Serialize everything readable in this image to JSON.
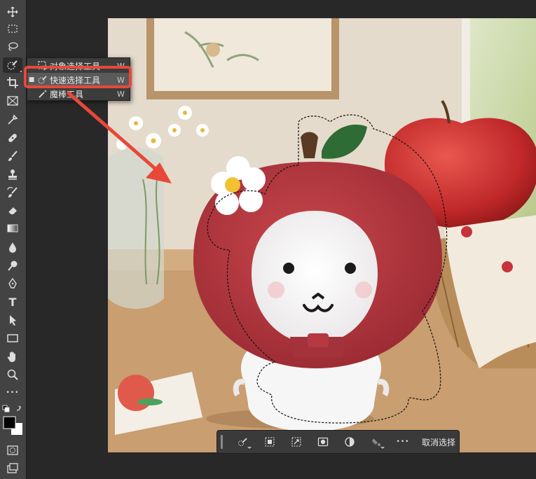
{
  "toolbar": {
    "tools": [
      "move-tool-icon",
      "marquee-tool-icon",
      "lasso-tool-icon",
      "quick-selection-tool-icon",
      "crop-tool-icon",
      "frame-tool-icon",
      "eyedropper-tool-icon",
      "healing-brush-tool-icon",
      "brush-tool-icon",
      "clone-stamp-tool-icon",
      "history-brush-tool-icon",
      "eraser-tool-icon",
      "gradient-tool-icon",
      "blur-tool-icon",
      "dodge-tool-icon",
      "pen-tool-icon",
      "type-tool-icon",
      "path-selection-tool-icon",
      "rectangle-tool-icon",
      "hand-tool-icon",
      "zoom-tool-icon",
      "more-tools-icon"
    ],
    "type_glyph": "T",
    "more_glyph": "•••",
    "active_tool": "quick-selection-tool-icon"
  },
  "flyout": {
    "items": [
      {
        "label": "对象选择工具",
        "shortcut": "W",
        "selected": false
      },
      {
        "label": "快速选择工具",
        "shortcut": "W",
        "selected": true
      },
      {
        "label": "魔棒工具",
        "shortcut": "W",
        "selected": false
      }
    ],
    "bullet": "■"
  },
  "contextual_bar": {
    "more": "•••",
    "deselect_label": "取消选择"
  },
  "colors": {
    "foreground": "#000000",
    "background": "#ffffff",
    "highlight": "#e8483a"
  }
}
